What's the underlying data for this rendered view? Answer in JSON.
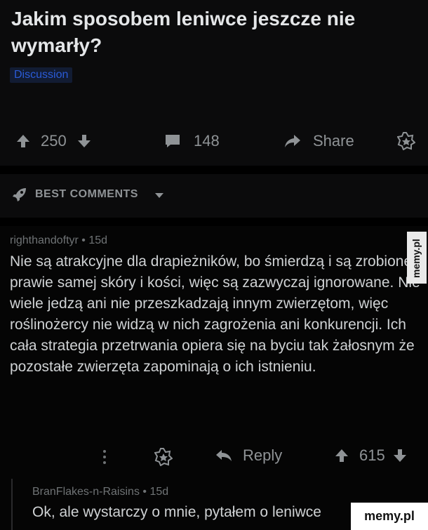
{
  "post": {
    "title": "Jakim sposobem leniwce jeszcze nie wymarły?",
    "flair": "Discussion",
    "upvotes": "250",
    "comments": "148",
    "share_label": "Share"
  },
  "sort": {
    "label": "BEST COMMENTS"
  },
  "comment": {
    "author": "righthandoftyr",
    "age": "15d",
    "text": "Nie są atrakcyjne dla drapieżników, bo śmierdzą i są zrobione z prawie samej skóry i kości, więc są zazwyczaj ignorowane. Nie wiele jedzą ani nie przeszkadzają innym zwierzętom, więc roślinożercy nie widzą w nich zagrożenia ani konkurencji. Ich cała strategia przetrwania opiera się na byciu tak żałosnym że pozostałe zwierzęta zapominają o ich istnieniu.",
    "reply_label": "Reply",
    "votes": "615"
  },
  "reply": {
    "author": "BranFlakes-n-Raisins",
    "age": "15d",
    "text": "Ok, ale wystarczy o mnie, pytałem o leniwce"
  },
  "watermark": {
    "side": "memy.pl",
    "bottom": "memy.pl"
  }
}
